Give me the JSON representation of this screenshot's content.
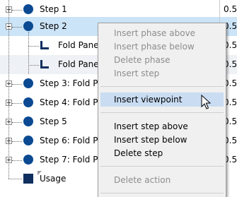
{
  "tree": {
    "rows": [
      {
        "label": "Step 1",
        "value": "0.5"
      },
      {
        "label": "Step 2",
        "value": "0.5"
      },
      {
        "label": "Fold Panel",
        "value": "0.5"
      },
      {
        "label": "Fold Panel",
        "value": "0.5"
      },
      {
        "label": "Step 3: Fold Pan",
        "value": "0.5"
      },
      {
        "label": "Step 4: Fold Pan",
        "value": "0.5"
      },
      {
        "label": "Step 5",
        "value": "0.5"
      },
      {
        "label": "Step 6: Fold Pan",
        "value": "0.5"
      },
      {
        "label": "Step 7: Fold Pan",
        "value": "0.5"
      },
      {
        "label": "Usage",
        "value": ""
      }
    ]
  },
  "context_menu": {
    "items": [
      {
        "label": "Insert phase above",
        "enabled": false
      },
      {
        "label": "Insert phase below",
        "enabled": false
      },
      {
        "label": "Delete phase",
        "enabled": false
      },
      {
        "label": "Insert step",
        "enabled": false
      },
      {
        "label": "Insert viewpoint",
        "enabled": true,
        "highlighted": true
      },
      {
        "label": "Insert step above",
        "enabled": true
      },
      {
        "label": "Insert step below",
        "enabled": true
      },
      {
        "label": "Delete step",
        "enabled": true
      },
      {
        "label": "Delete action",
        "enabled": false
      }
    ]
  },
  "colors": {
    "selection": "#cce4f7",
    "node_blue": "#0b4a92",
    "menu_hover": "#c9dcf2",
    "disabled_text": "#8d8d8d"
  }
}
